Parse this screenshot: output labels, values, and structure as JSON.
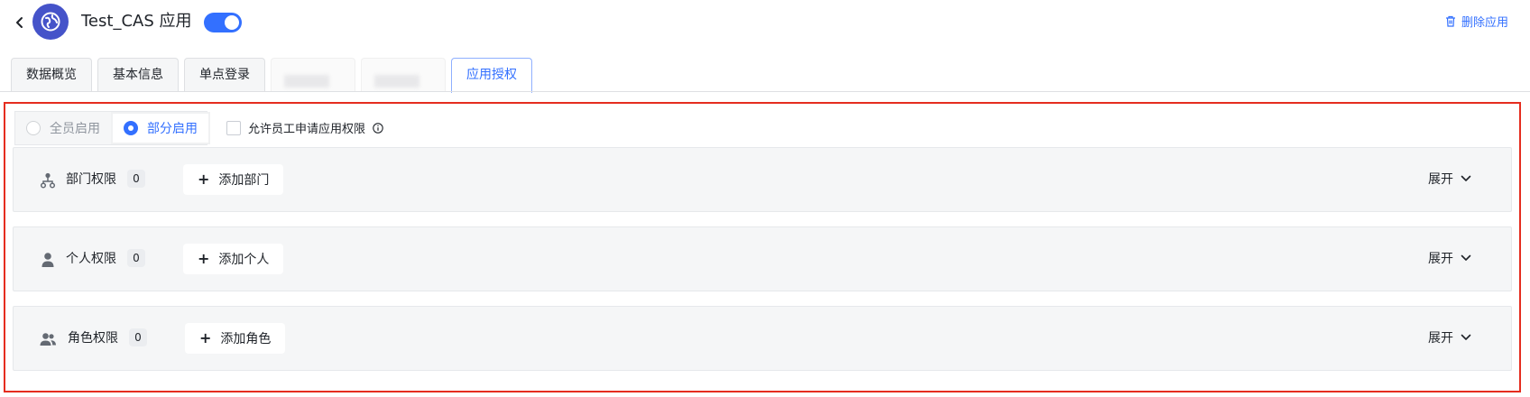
{
  "header": {
    "back_icon": "chevron-left-icon",
    "logo_icon": "globe-icon",
    "app_name": "Test_CAS 应用",
    "enabled": true,
    "delete_label": "删除应用",
    "delete_icon": "trash-icon",
    "accent_color": "#3370ff"
  },
  "tabs": [
    {
      "label": "数据概览",
      "active": false
    },
    {
      "label": "基本信息",
      "active": false
    },
    {
      "label": "单点登录",
      "active": false
    },
    {
      "label": "",
      "active": false
    },
    {
      "label": "",
      "active": false
    },
    {
      "label": "应用授权",
      "active": true
    }
  ],
  "authorization": {
    "scope_options": [
      {
        "label": "全员启用",
        "selected": false
      },
      {
        "label": "部分启用",
        "selected": true
      }
    ],
    "allow_request_label": "允许员工申请应用权限",
    "allow_request_checked": false,
    "info_icon": "info-icon",
    "sections": [
      {
        "label": "部门权限",
        "count": "0",
        "add_label": "添加部门",
        "expand_label": "展开",
        "icon": "org-chart-icon"
      },
      {
        "label": "个人权限",
        "count": "0",
        "add_label": "添加个人",
        "expand_label": "展开",
        "icon": "user-icon"
      },
      {
        "label": "角色权限",
        "count": "0",
        "add_label": "添加角色",
        "expand_label": "展开",
        "icon": "users-icon"
      }
    ]
  },
  "highlight_color": "#e52d1f"
}
